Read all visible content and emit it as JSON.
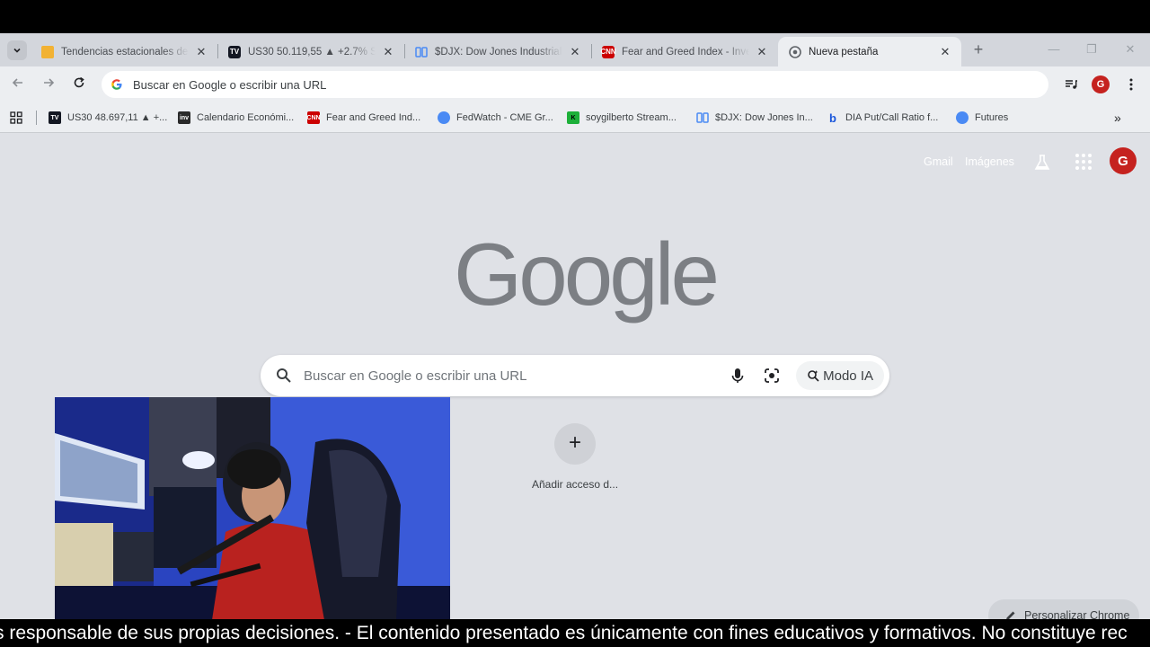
{
  "tabs": [
    {
      "title": "Tendencias estacionales del",
      "favicon": "folder-icon",
      "color": "#f2b233"
    },
    {
      "title": "US30 50.119,55 ▲ +2.7% Sin",
      "favicon": "tradingview-icon",
      "color": "#131722"
    },
    {
      "title": "$DJX: Dow Jones Industrials",
      "favicon": "chart-icon",
      "color": "#4a8af4"
    },
    {
      "title": "Fear and Greed Index - Inve",
      "favicon": "cnn-icon",
      "color": "#cc0000"
    },
    {
      "title": "Nueva pestaña",
      "favicon": "chrome-icon",
      "color": "#5f6368",
      "active": true
    }
  ],
  "toolbar": {
    "address": "Buscar en Google o escribir una URL",
    "profile_initial": "G"
  },
  "bookmarks": [
    {
      "label": "US30 48.697,11 ▲ +...",
      "favicon": "tradingview-icon",
      "color": "#131722"
    },
    {
      "label": "Calendario Económi...",
      "favicon": "investing-icon",
      "color": "#2a2a2a"
    },
    {
      "label": "Fear and Greed Ind...",
      "favicon": "cnn-icon",
      "color": "#cc0000"
    },
    {
      "label": "FedWatch - CME Gr...",
      "favicon": "globe-icon",
      "color": "#4a8af4"
    },
    {
      "label": "soygilberto Stream...",
      "favicon": "kick-icon",
      "color": "#1db03a"
    },
    {
      "label": "$DJX: Dow Jones In...",
      "favicon": "chart-icon",
      "color": "#4a8af4"
    },
    {
      "label": "DIA Put/Call Ratio f...",
      "favicon": "barchart-b-icon",
      "color": "#1a56db"
    },
    {
      "label": "Futures",
      "favicon": "futures-icon",
      "color": "#4a8af4"
    }
  ],
  "ntp": {
    "gmail": "Gmail",
    "imagenes": "Imágenes",
    "profile_initial": "G",
    "logo": "Google",
    "search_placeholder": "Buscar en Google o escribir una URL",
    "ai_mode": "Modo IA",
    "add_shortcut": "+",
    "add_shortcut_label": "Añadir acceso d...",
    "customize": "Personalizar Chrome"
  },
  "ticker": {
    "text": "s responsable de sus propias decisiones.  - El contenido presentado es únicamente con fines educativos y formativos. No constituye rec"
  },
  "colors": {
    "avatar": "#c5221f",
    "page_bg": "#dfe1e6",
    "tabstrip_bg": "#d3d6dc"
  }
}
